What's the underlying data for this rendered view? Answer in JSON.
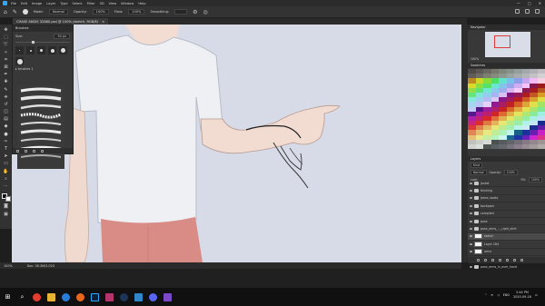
{
  "menubar": {
    "items": [
      "File",
      "Edit",
      "Image",
      "Layer",
      "Type",
      "Select",
      "Filter",
      "3D",
      "View",
      "Window",
      "Help"
    ],
    "window_controls": [
      "—",
      "▢",
      "✕"
    ]
  },
  "options": {
    "mode_label": "Mode:",
    "mode_value": "Normal",
    "opacity_label": "Opacity:",
    "opacity_value": "100%",
    "flow_label": "Flow:",
    "flow_value": "100%",
    "smoothing_label": "Smoothing:"
  },
  "document": {
    "tab_title": "CHASE ANGIE 32880.psd @ 100% (sketch, RGB/8)",
    "close": "×"
  },
  "brushes_panel": {
    "title": "Brushes",
    "size_label": "Size:",
    "size_value": "50 px",
    "folder_label": "▸ brushes 1",
    "preset_sizes": [
      "1",
      "3",
      "5",
      "7",
      "9",
      "11"
    ]
  },
  "navigator": {
    "title": "Navigator",
    "zoom": "100%"
  },
  "swatches": {
    "title": "Swatches"
  },
  "layers": {
    "title": "Layers",
    "kind_label": "Kind",
    "blend_mode": "Normal",
    "opacity_label": "Opacity:",
    "opacity_value": "100%",
    "lock_label": "Lock:",
    "fill_label": "Fill:",
    "fill_value": "100%",
    "items": [
      {
        "name": "jacket",
        "type": "folder"
      },
      {
        "name": "thinking",
        "type": "folder"
      },
      {
        "name": "jeans, boots",
        "type": "folder"
      },
      {
        "name": "backpack",
        "type": "folder"
      },
      {
        "name": "complied",
        "type": "folder"
      },
      {
        "name": "pose",
        "type": "folder"
      },
      {
        "name": "pose_arms_..._right_shirt",
        "type": "folder"
      },
      {
        "name": "sketch",
        "type": "layer",
        "selected": true
      },
      {
        "name": "Layer 184",
        "type": "layer"
      },
      {
        "name": "arms",
        "type": "layer"
      },
      {
        "name": "pose_arms_...pose_back",
        "type": "folder"
      },
      {
        "name": "pose_arms_in_over_hand",
        "type": "folder"
      }
    ]
  },
  "statusbar": {
    "zoom": "100%",
    "doc": "Doc: 36.3M/3.02G"
  },
  "taskbar": {
    "apps": [
      "start-icon",
      "search-icon",
      "chrome-icon",
      "explorer-icon",
      "edge-icon",
      "firefox-icon",
      "photoshop-icon",
      "illustrator-icon",
      "steam-icon",
      "folder-icon",
      "discord-icon",
      "settings-icon"
    ],
    "language": "ENG",
    "time": "2:44 PM",
    "date": "2020-09-18"
  }
}
